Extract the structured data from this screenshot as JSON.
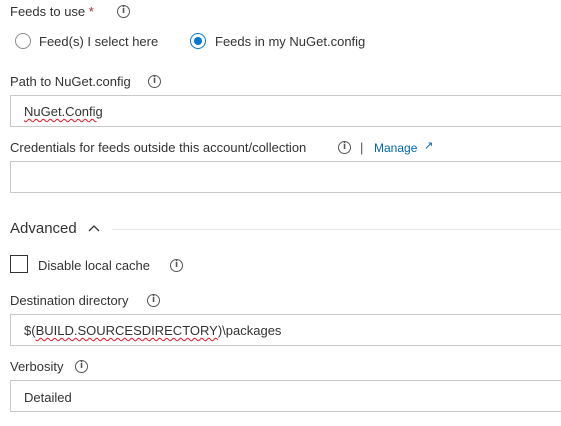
{
  "feeds": {
    "label": "Feeds to use",
    "required": "*",
    "info_icon": "i",
    "option_select": "Feed(s) I select here",
    "option_nuget": "Feeds in my NuGet.config",
    "selected": "Feeds in my NuGet.config"
  },
  "path": {
    "label": "Path to NuGet.config",
    "info_icon": "i",
    "value": "NuGet.Config"
  },
  "credentials": {
    "label": "Credentials for feeds outside this account/collection",
    "info_icon": "i",
    "separator": "|",
    "manage_label": "Manage",
    "manage_icon": "↗",
    "value": ""
  },
  "advanced": {
    "label": "Advanced",
    "chevron_icon": "chevron-up"
  },
  "cache": {
    "label": "Disable local cache",
    "info_icon": "i",
    "checked": false
  },
  "destination": {
    "label": "Destination directory",
    "info_icon": "i",
    "value_prefix": "$(",
    "value_var": "BUILD.SOURCESDIRECTORY",
    "value_suffix": ")\\packages"
  },
  "verbosity": {
    "label": "Verbosity",
    "info_icon": "i",
    "value": "Detailed"
  },
  "colors": {
    "accent": "#0078d4",
    "link": "#0066b4",
    "border": "#c8c8c8",
    "text": "#333333",
    "required": "#a4262c"
  }
}
